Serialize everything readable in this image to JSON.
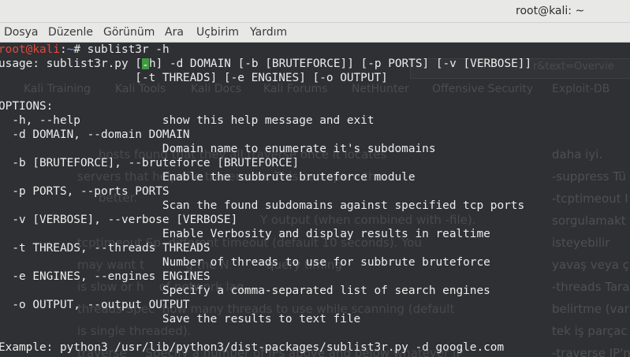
{
  "window": {
    "title": "root@kali: ~"
  },
  "menubar": {
    "items": [
      "Dosya",
      "Düzenle",
      "Görünüm",
      "Ara",
      "Uçbirim",
      "Yardım"
    ]
  },
  "terminal": {
    "prompt_user": "root@kali",
    "prompt_sep": ":",
    "prompt_path": "~",
    "prompt_symbol": "#",
    "command": " sublist3r -h",
    "usage_1a": "usage: sublist3r.py [",
    "usage_1b": "-",
    "usage_1c": "h] -d DOMAIN [-b [BRUTEFORCE]] [-p PORTS] [-v [VERBOSE]]",
    "usage_2": "                    [-t THREADS] [-e ENGINES] [-o OUTPUT]",
    "options_header": "OPTIONS:",
    "opt_h": "  -h, --help            show this help message and exit",
    "opt_d": "  -d DOMAIN, --domain DOMAIN",
    "opt_d_desc": "                        Domain name to enumerate it's subdomains",
    "opt_b": "  -b [BRUTEFORCE], --bruteforce [BRUTEFORCE]",
    "opt_b_desc": "                        Enable the subbrute bruteforce module",
    "opt_p": "  -p PORTS, --ports PORTS",
    "opt_p_desc": "                        Scan the found subdomains against specified tcp ports",
    "opt_v": "  -v [VERBOSE], --verbose [VERBOSE]",
    "opt_v_desc": "                        Enable Verbosity and display results in realtime",
    "opt_t": "  -t THREADS, --threads THREADS",
    "opt_t_desc": "                        Number of threads to use for subbrute bruteforce",
    "opt_e": "  -e ENGINES, --engines ENGINES",
    "opt_e_desc": "                        Specify a comma-separated list of search engines",
    "opt_o": "  -o OUTPUT, --output OUTPUT",
    "opt_o_desc": "                        Save the results to text file",
    "example": "Example: python3 /usr/lib/python3/dist-packages/sublist3r.py -d google.com"
  },
  "background_page": {
    "url_fragment": "r&text=Overvie",
    "bookmarks": [
      "Kali Training",
      "Kali Tools",
      "Kali Docs",
      "Kali Forums",
      "NetHunter",
      "Offensive Security",
      "Exploit-DB"
    ],
    "left_lines": [
      "hosts found that they all traverse once it locates",
      "servers that help the traceroute. This can spare the",
      "better.",
      "Y output (when combined with -file).",
      "tcptimeout Sp  different timeout (default 10 seconds). You",
      "may want t           g the N          query timing",
      "is slow or h    of network lag.",
      "threads Spec  how many threads to use while scanning (default",
      "is single threaded).",
      "traverse     Specify a number of IPs above and below whatever IP"
    ],
    "right_lines": [
      "daha iyi.",
      "-suppress Tü",
      "-tcptimeout I",
      "sorgulamakt",
      "isteyebilir",
      "yavaş veya ç",
      "-threads Tara",
      "belirtme (var",
      "tek iş parçac",
      "-traverse IP'n"
    ]
  }
}
